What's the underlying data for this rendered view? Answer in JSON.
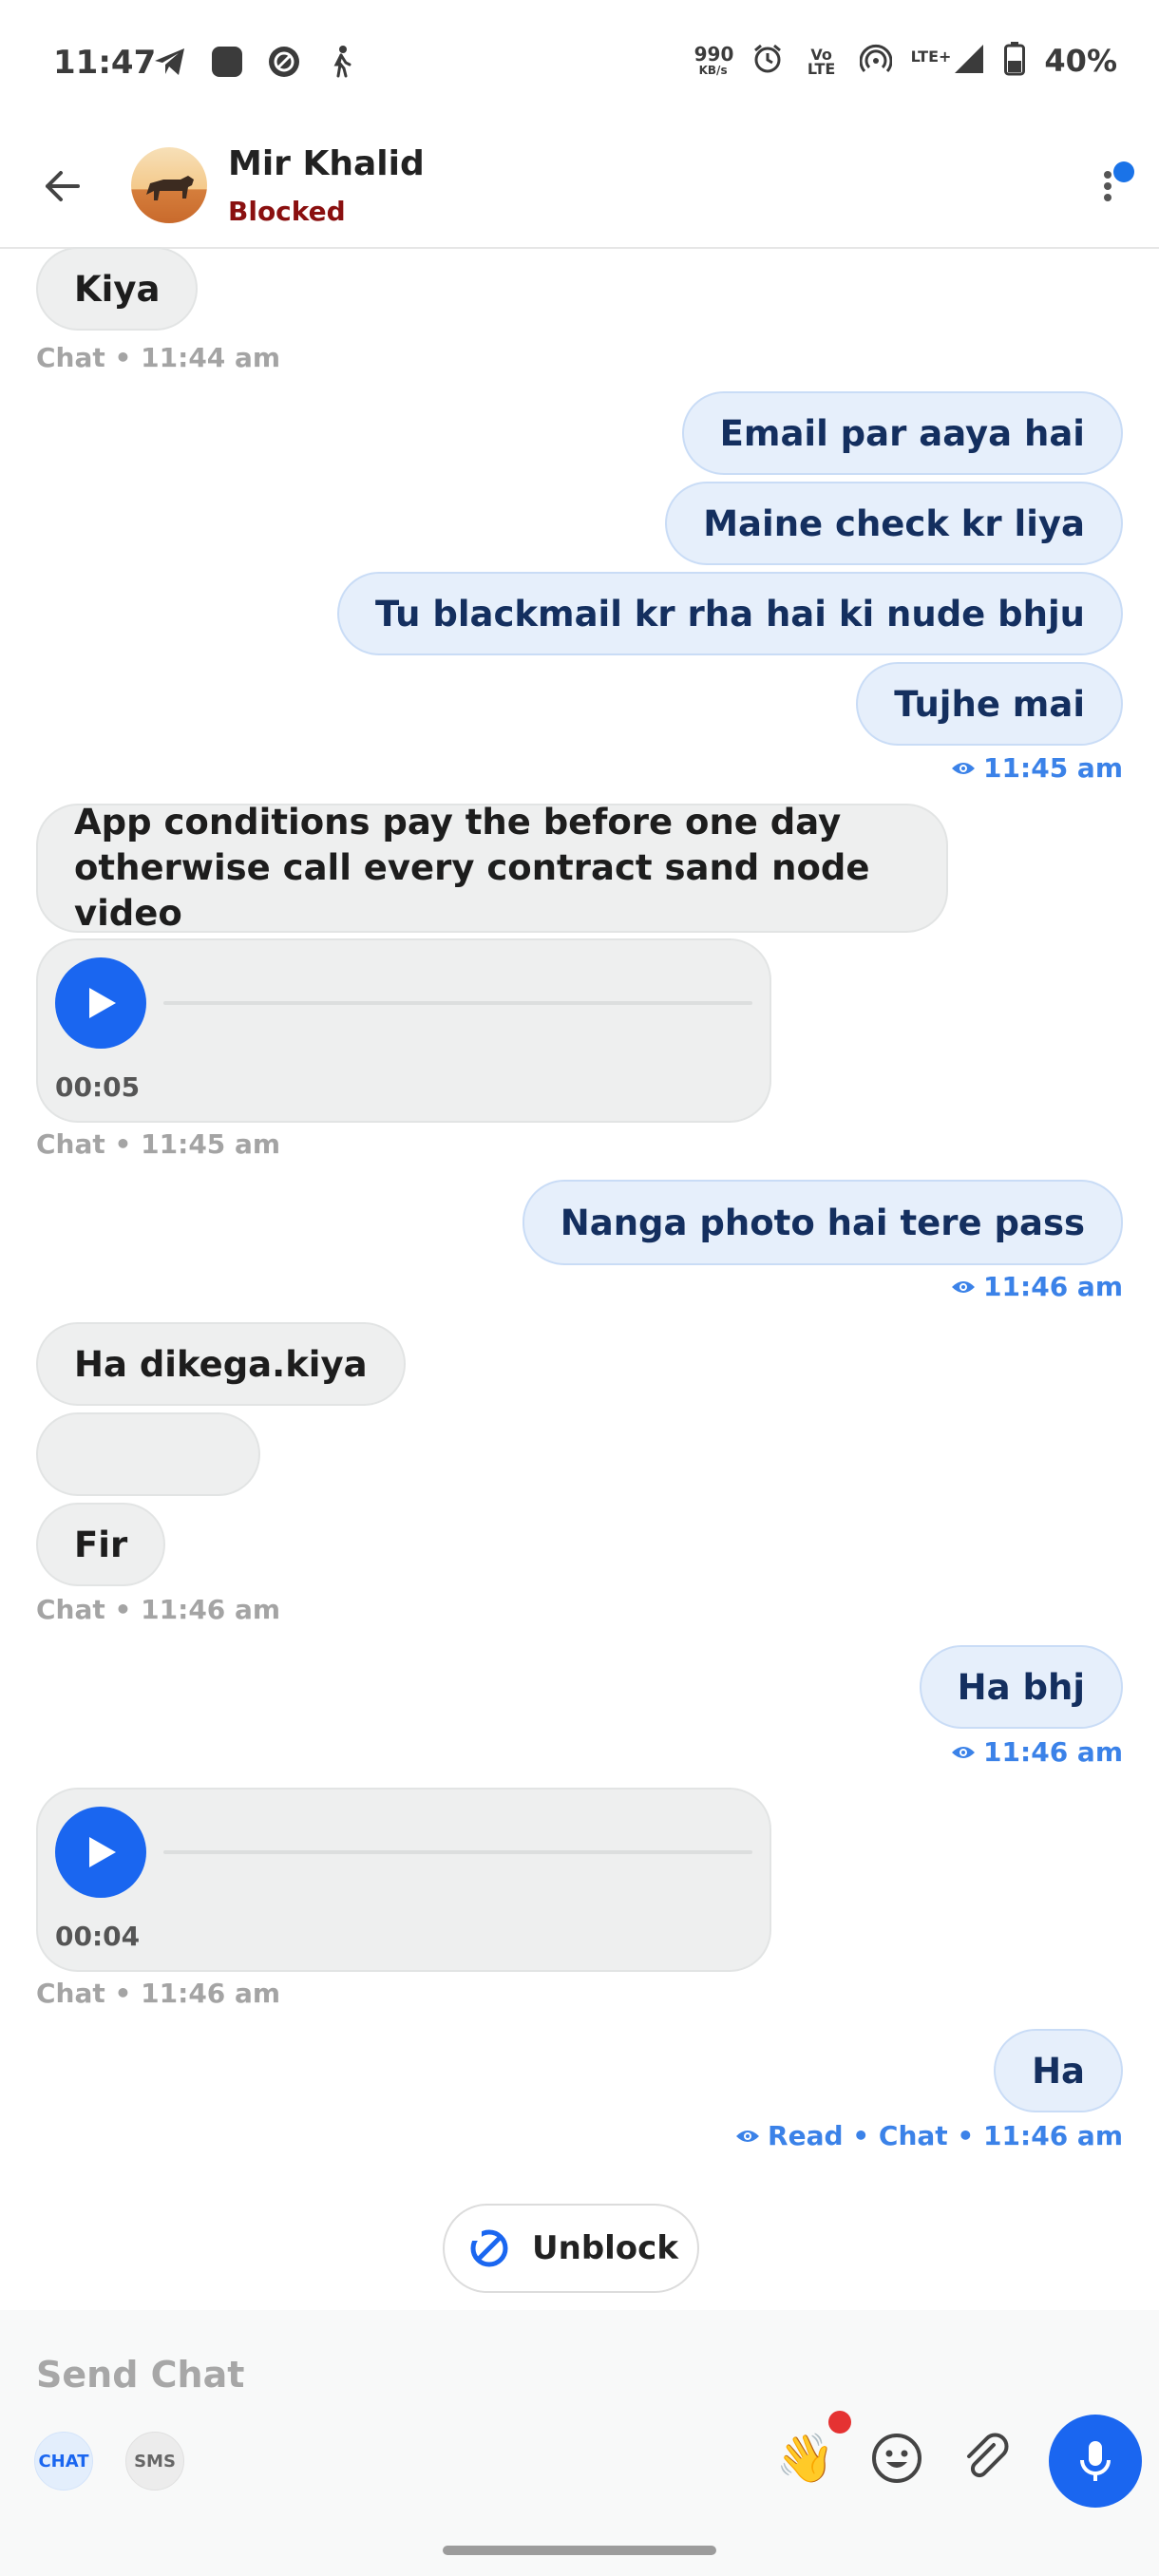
{
  "status_bar": {
    "time": "11:47",
    "net_speed_top": "990",
    "net_speed_bottom": "KB/s",
    "volte_top": "Vo",
    "volte_bottom": "LTE",
    "lte_label": "LTE+",
    "battery": "40%"
  },
  "header": {
    "contact_name": "Mir Khalid",
    "contact_status": "Blocked"
  },
  "messages": {
    "m1": "Kiya",
    "m1_meta": "Chat • 11:44 am",
    "m2": "Email par aaya hai",
    "m3": "Maine check kr liya",
    "m4": "Tu blackmail kr rha hai ki nude bhju",
    "m5": "Tujhe mai",
    "m5_meta": "11:45 am",
    "m6": "App conditions pay the before one day otherwise call every contract sand node video",
    "voice1_duration": "00:05",
    "voice1_meta": "Chat • 11:45 am",
    "m7": "Nanga photo hai tere pass",
    "m7_meta": "11:46 am",
    "m8": "Ha dikega.kiya",
    "m9": "Fir",
    "m9_meta": "Chat • 11:46 am",
    "m10": "Ha bhj",
    "m10_meta": "11:46 am",
    "voice2_duration": "00:04",
    "voice2_meta": "Chat • 11:46 am",
    "m11": "Ha",
    "m11_meta": "Read • Chat • 11:46 am"
  },
  "unblock_label": "Unblock",
  "composer": {
    "placeholder": "Send Chat",
    "mode_chat": "CHAT",
    "mode_sms": "SMS",
    "wave_emoji": "👋"
  },
  "colors": {
    "accent": "#1a66f0",
    "blocked": "#8a1010",
    "outgoing_meta": "#3b82e8"
  }
}
